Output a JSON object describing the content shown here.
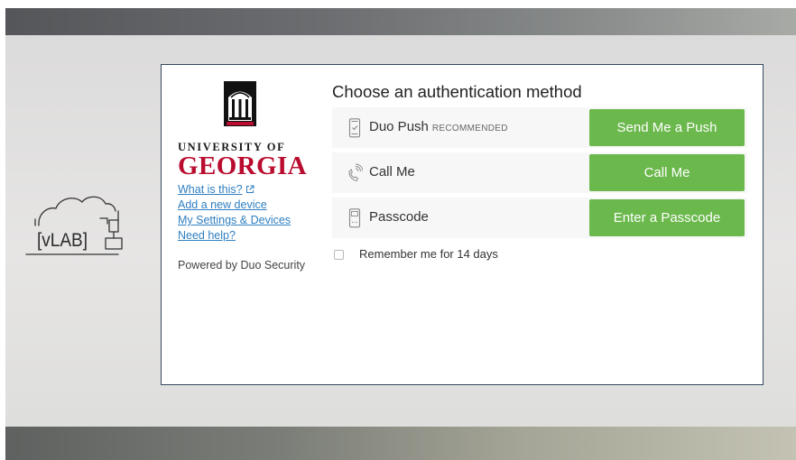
{
  "colors": {
    "brand_red": "#ba0c2f",
    "button_green": "#6bb84c",
    "link_blue": "#2f7fc1",
    "frame_border": "#34495e"
  },
  "sidebar": {
    "logo_icon": "arch-icon",
    "university_line": "UNIVERSITY OF",
    "university_name": "GEORGIA",
    "links": {
      "what_is_this": "What is this?",
      "add_device": "Add a new device",
      "settings": "My Settings & Devices",
      "help": "Need help?"
    },
    "powered_by": "Powered by Duo Security"
  },
  "vlab_logo": {
    "text": "[vLAB]"
  },
  "auth": {
    "heading": "Choose an authentication method",
    "methods": [
      {
        "icon": "phone-check-icon",
        "label": "Duo Push",
        "badge": "RECOMMENDED",
        "button": "Send Me a Push"
      },
      {
        "icon": "phone-call-icon",
        "label": "Call Me",
        "button": "Call Me"
      },
      {
        "icon": "passcode-icon",
        "label": "Passcode",
        "button": "Enter a Passcode"
      }
    ],
    "remember_label": "Remember me for 14 days",
    "remember_checked": false
  }
}
